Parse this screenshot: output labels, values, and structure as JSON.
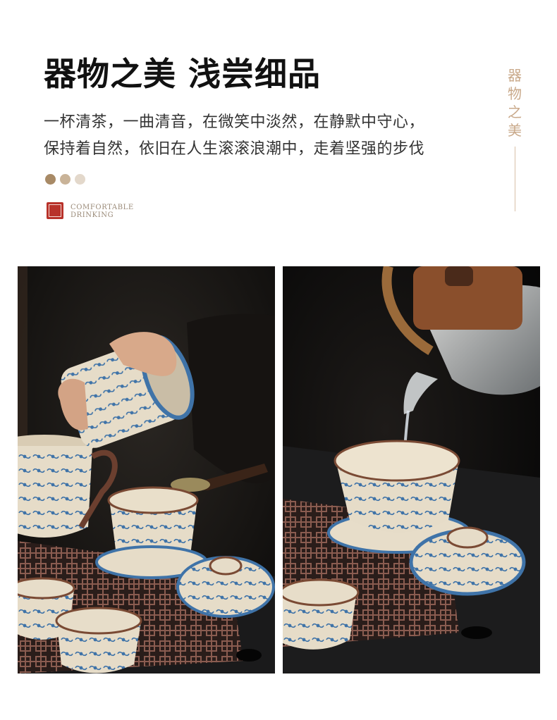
{
  "header": {
    "title": "器物之美 浅尝细品",
    "line1": "一杯清茶，一曲清音，在微笑中淡然，在静默中守心，",
    "line2": "保持着自然，依旧在人生滚滚浪潮中，走着坚强的步伐",
    "dot_colors": [
      "#a88a66",
      "#c9b398",
      "#e3d8cb"
    ],
    "seal_color": "#b8322a",
    "english_line1": "COMFORTABLE",
    "english_line2": "DRINKING"
  },
  "side_label": {
    "chars": [
      "器",
      "物",
      "之",
      "美"
    ]
  },
  "photos": {
    "left": {
      "subject": "hand holding blue-and-white tea caddy over gaiwan, tea scoop, cups on black tray"
    },
    "right": {
      "subject": "glass kettle with wooden lid pouring water into blue-and-white gaiwan on tray"
    }
  }
}
